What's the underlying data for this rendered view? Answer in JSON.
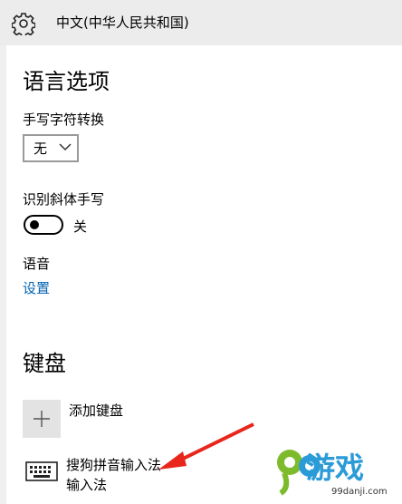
{
  "header": {
    "title": "中文(中华人民共和国)",
    "settings_icon": "gear-icon"
  },
  "language_options": {
    "heading": "语言选项",
    "handwriting": {
      "label": "手写字符转换",
      "selected_value": "无"
    },
    "italic_handwriting": {
      "label": "识别斜体手写",
      "toggle_state": "关"
    },
    "speech": {
      "label": "语音",
      "settings_link": "设置"
    }
  },
  "keyboards": {
    "heading": "键盘",
    "add_label": "添加键盘",
    "items": [
      {
        "name": "搜狗拼音输入法",
        "subtitle": "输入法",
        "icon": "keyboard-icon"
      }
    ]
  },
  "watermark": {
    "brand": "游戏",
    "domain": "99danji.com"
  },
  "colors": {
    "titlebar_bg": "#ececec",
    "link": "#0063b1",
    "annotation_arrow": "#e8261c",
    "watermark_blue": "#2b9bd8",
    "watermark_green": "#7dbb2d"
  }
}
